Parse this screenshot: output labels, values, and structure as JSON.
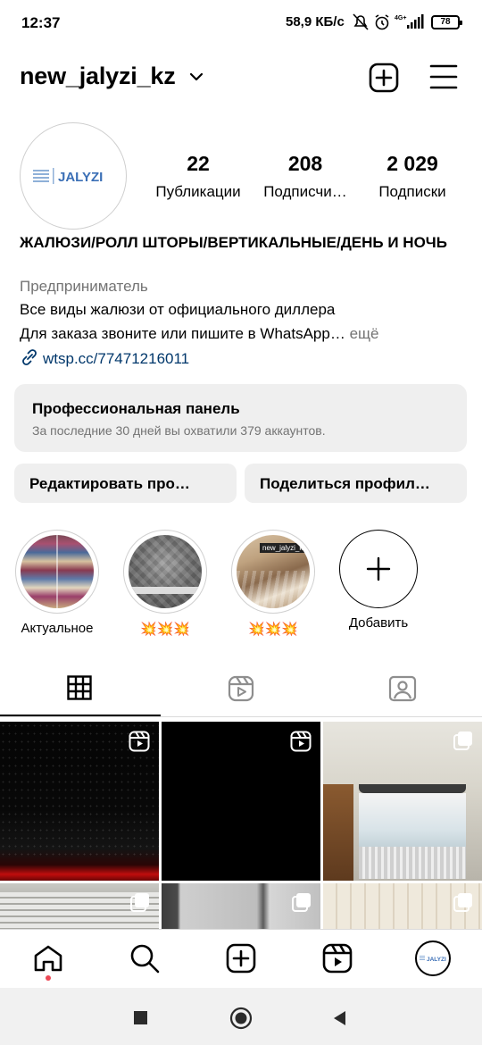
{
  "status_bar": {
    "time": "12:37",
    "speed": "58,9 КБ/с",
    "network": "4G+",
    "battery": "78"
  },
  "header": {
    "username": "new_jalyzi_kz"
  },
  "profile": {
    "avatar_text": "JALYZI",
    "stats": [
      {
        "value": "22",
        "label": "Публикации"
      },
      {
        "value": "208",
        "label": "Подписчи…"
      },
      {
        "value": "2 029",
        "label": "Подписки"
      }
    ],
    "name": "ЖАЛЮЗИ/РОЛЛ ШТОРЫ/ВЕРТИКАЛЬНЫЕ/ДЕНЬ И НОЧЬ",
    "category": "Предприниматель",
    "bio_line1": "Все виды жалюзи от официального диллера",
    "bio_line2": "Для заказа звоните или пишите в WhatsApp…",
    "bio_more": "ещё",
    "link": "wtsp.cc/77471216011"
  },
  "pro_panel": {
    "title": "Профессиональная панель",
    "subtitle": "За последние 30 дней вы охватили 379 аккаунтов."
  },
  "buttons": {
    "edit": "Редактировать про…",
    "share": "Поделиться профил…"
  },
  "highlights": [
    {
      "label": "Актуальное"
    },
    {
      "label": "💥💥💥"
    },
    {
      "label": "💥💥💥",
      "overlay_text": "new_jalyzi_kz"
    },
    {
      "label": "Добавить"
    }
  ],
  "colors": {
    "accent_link": "#00376b",
    "secondary_text": "#737373",
    "panel_bg": "#efefef",
    "notification_dot": "#ed4956"
  }
}
